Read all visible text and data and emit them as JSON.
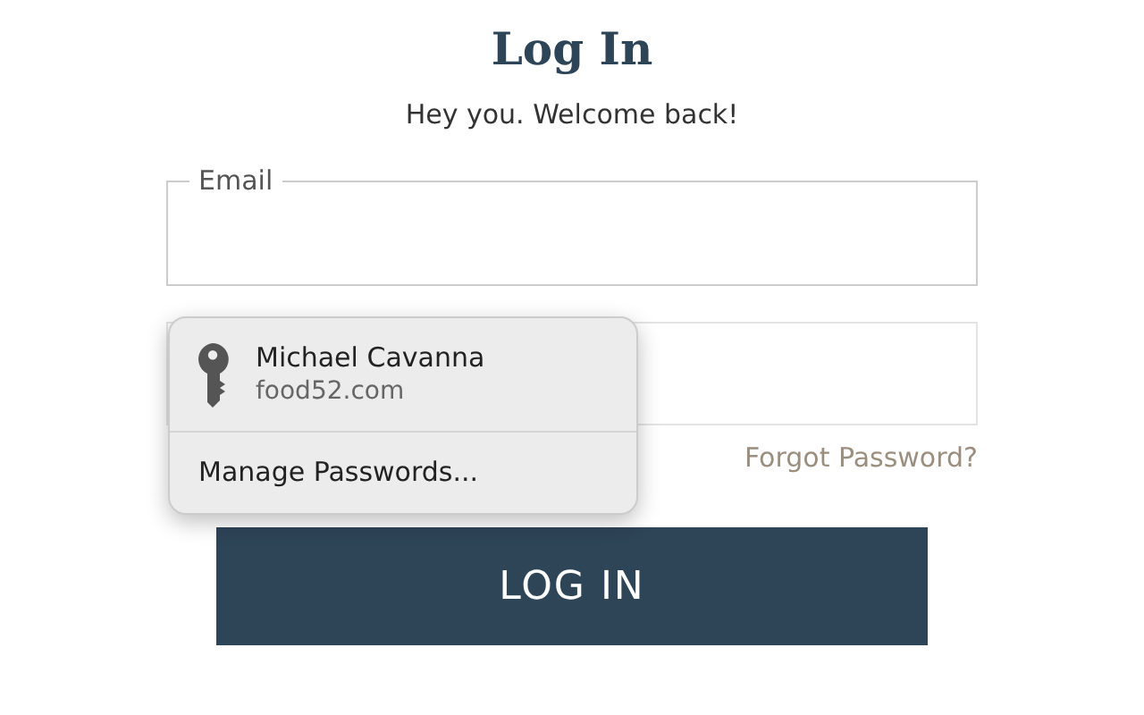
{
  "title": "Log In",
  "subtitle": "Hey you. Welcome back!",
  "email_field": {
    "label": "Email"
  },
  "forgot_link": "Forgot Password?",
  "login_button": "LOG IN",
  "autofill_popup": {
    "account": {
      "name": "Michael Cavanna",
      "site": "food52.com"
    },
    "manage": "Manage Passwords..."
  }
}
